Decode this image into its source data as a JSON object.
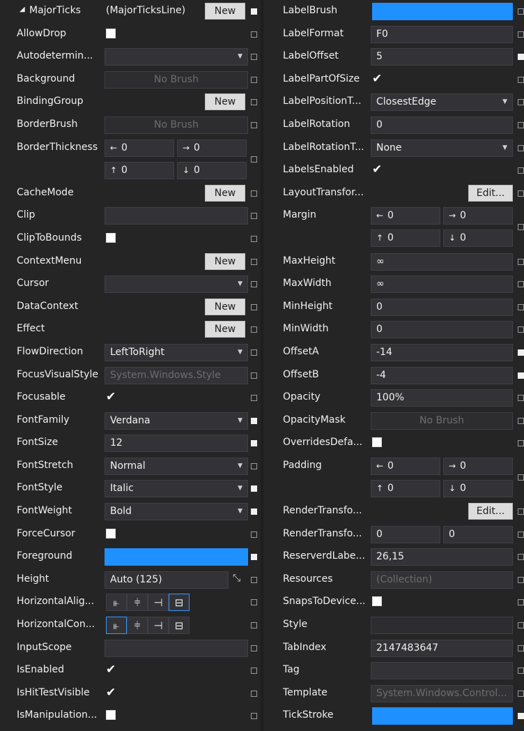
{
  "left": {
    "major_ticks": {
      "label": "MajorTicks",
      "value": "(MajorTicksLine)",
      "button": "New"
    },
    "allow_drop": {
      "label": "AllowDrop"
    },
    "autodetermine": {
      "label": "Autodetermin..."
    },
    "background": {
      "label": "Background",
      "value": "No Brush"
    },
    "binding_group": {
      "label": "BindingGroup",
      "button": "New"
    },
    "border_brush": {
      "label": "BorderBrush",
      "value": "No Brush"
    },
    "border_thickness": {
      "label": "BorderThickness",
      "left": "0",
      "right": "0",
      "top": "0",
      "bottom": "0"
    },
    "cache_mode": {
      "label": "CacheMode",
      "button": "New"
    },
    "clip": {
      "label": "Clip"
    },
    "clip_to_bounds": {
      "label": "ClipToBounds"
    },
    "context_menu": {
      "label": "ContextMenu",
      "button": "New"
    },
    "cursor": {
      "label": "Cursor"
    },
    "data_context": {
      "label": "DataContext",
      "button": "New"
    },
    "effect": {
      "label": "Effect",
      "button": "New"
    },
    "flow_direction": {
      "label": "FlowDirection",
      "value": "LeftToRight"
    },
    "focus_visual_style": {
      "label": "FocusVisualStyle",
      "value": "System.Windows.Style"
    },
    "focusable": {
      "label": "Focusable",
      "checked": "✔"
    },
    "font_family": {
      "label": "FontFamily",
      "value": "Verdana"
    },
    "font_size": {
      "label": "FontSize",
      "value": "12"
    },
    "font_stretch": {
      "label": "FontStretch",
      "value": "Normal"
    },
    "font_style": {
      "label": "FontStyle",
      "value": "Italic"
    },
    "font_weight": {
      "label": "FontWeight",
      "value": "Bold"
    },
    "force_cursor": {
      "label": "ForceCursor"
    },
    "foreground": {
      "label": "Foreground",
      "color": "#1e90ff"
    },
    "height": {
      "label": "Height",
      "value": "Auto (125)",
      "icon": "⤡"
    },
    "horizontal_alignment": {
      "label": "HorizontalAlig..."
    },
    "horizontal_content": {
      "label": "HorizontalCon..."
    },
    "input_scope": {
      "label": "InputScope"
    },
    "is_enabled": {
      "label": "IsEnabled",
      "checked": "✔"
    },
    "is_hit_test_visible": {
      "label": "IsHitTestVisible",
      "checked": "✔"
    },
    "is_manipulation": {
      "label": "IsManipulation..."
    }
  },
  "right": {
    "label_brush": {
      "label": "LabelBrush",
      "color": "#1e90ff"
    },
    "label_format": {
      "label": "LabelFormat",
      "value": "F0"
    },
    "label_offset": {
      "label": "LabelOffset",
      "value": "5"
    },
    "label_part_of_size": {
      "label": "LabelPartOfSize",
      "checked": "✔"
    },
    "label_position": {
      "label": "LabelPositionT...",
      "value": "ClosestEdge"
    },
    "label_rotation": {
      "label": "LabelRotation",
      "value": "0"
    },
    "label_rotation_t": {
      "label": "LabelRotationT...",
      "value": "None"
    },
    "labels_enabled": {
      "label": "LabelsEnabled",
      "checked": "✔"
    },
    "layout_transform": {
      "label": "LayoutTransfor...",
      "button": "Edit..."
    },
    "margin": {
      "label": "Margin",
      "left": "0",
      "right": "0",
      "top": "0",
      "bottom": "0"
    },
    "max_height": {
      "label": "MaxHeight",
      "value": "∞"
    },
    "max_width": {
      "label": "MaxWidth",
      "value": "∞"
    },
    "min_height": {
      "label": "MinHeight",
      "value": "0"
    },
    "min_width": {
      "label": "MinWidth",
      "value": "0"
    },
    "offset_a": {
      "label": "OffsetA",
      "value": "-14"
    },
    "offset_b": {
      "label": "OffsetB",
      "value": "-4"
    },
    "opacity": {
      "label": "Opacity",
      "value": "100%"
    },
    "opacity_mask": {
      "label": "OpacityMask",
      "value": "No Brush"
    },
    "overrides_default": {
      "label": "OverridesDefa..."
    },
    "padding": {
      "label": "Padding",
      "left": "0",
      "right": "0",
      "top": "0",
      "bottom": "0"
    },
    "render_transform": {
      "label": "RenderTransfo...",
      "button": "Edit..."
    },
    "render_transform_origin": {
      "label": "RenderTransfo...",
      "x": "0",
      "y": "0"
    },
    "reserved_label": {
      "label": "ReserverdLabe...",
      "value": "26,15"
    },
    "resources": {
      "label": "Resources",
      "value": "(Collection)"
    },
    "snaps_to_device": {
      "label": "SnapsToDevice..."
    },
    "style": {
      "label": "Style"
    },
    "tab_index": {
      "label": "TabIndex",
      "value": "2147483647"
    },
    "tag": {
      "label": "Tag"
    },
    "template": {
      "label": "Template",
      "value": "System.Windows.Control..."
    },
    "tick_stroke": {
      "label": "TickStroke",
      "color": "#1e90ff"
    }
  },
  "glyphs": {
    "expand": "◢",
    "caret": "▼",
    "arrow_left": "←",
    "arrow_right": "→",
    "arrow_up": "↑",
    "arrow_down": "↓",
    "align_left": "⫦",
    "align_center": "⫩",
    "align_right": "⊣",
    "align_stretch": "⊟"
  }
}
